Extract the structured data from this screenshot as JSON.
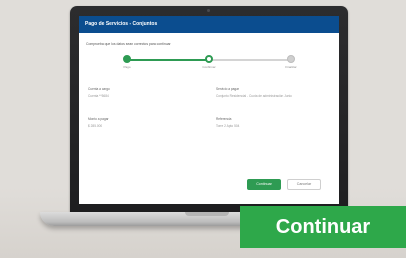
{
  "app": {
    "header_title": "Pago de Servicios - Conjuntos"
  },
  "intro": {
    "text": "Comprueba que los datos sean correctos para continuar"
  },
  "stepper": {
    "steps": [
      {
        "label": "Pago",
        "state": "done"
      },
      {
        "label": "Confirmar",
        "state": "current"
      },
      {
        "label": "Finalizar",
        "state": "todo"
      }
    ]
  },
  "fields": [
    {
      "label": "Cuenta a cargo",
      "value": "Cuenta **5684"
    },
    {
      "label": "Servicio a pagar",
      "value": "Conjunto Residencial - Cuota de administración Junio"
    },
    {
      "label": "Monto a pagar",
      "value": "$ 285.000"
    },
    {
      "label": "Referencia",
      "value": "Torre 2 Apto 504"
    }
  ],
  "actions": {
    "primary_label": "Continuar",
    "secondary_label": "Cancelar"
  },
  "cta": {
    "label": "Continuar"
  },
  "colors": {
    "header_blue": "#0b4d8f",
    "accent_green": "#2ea84a"
  }
}
